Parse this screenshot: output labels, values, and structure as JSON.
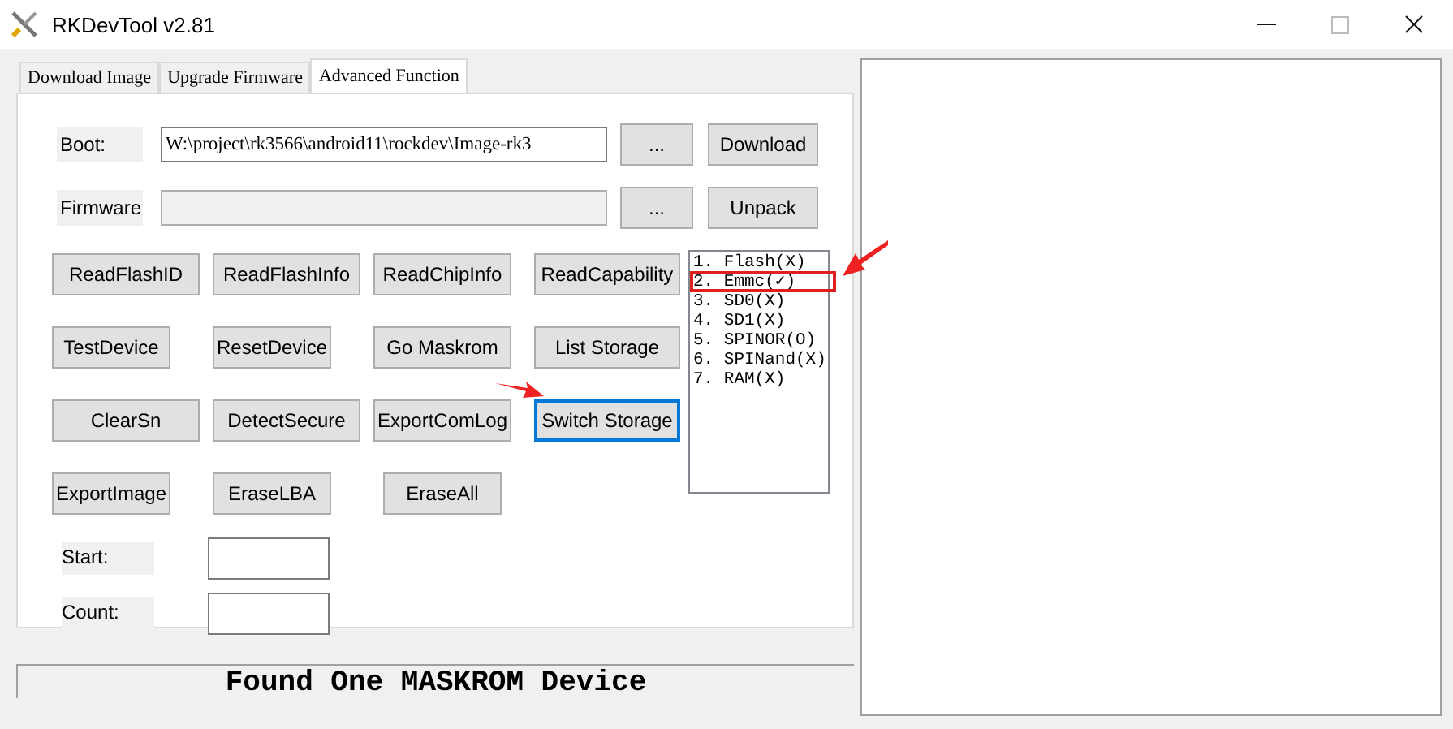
{
  "window": {
    "title": "RKDevTool v2.81"
  },
  "tabs": [
    {
      "label": "Download Image",
      "selected": false
    },
    {
      "label": "Upgrade Firmware",
      "selected": false
    },
    {
      "label": "Advanced Function",
      "selected": true
    }
  ],
  "boot": {
    "label": "Boot:",
    "value": "W:\\project\\rk3566\\android11\\rockdev\\Image-rk3",
    "browse": "...",
    "action": "Download"
  },
  "firmware": {
    "label": "Firmware",
    "browse": "...",
    "action": "Unpack"
  },
  "buttons": [
    {
      "label": "ReadFlashID",
      "focused": false,
      "pointed": false
    },
    {
      "label": "ReadFlashInfo",
      "focused": false,
      "pointed": false
    },
    {
      "label": "ReadChipInfo",
      "focused": false,
      "pointed": false
    },
    {
      "label": "ReadCapability",
      "focused": false,
      "pointed": false
    },
    {
      "label": "TestDevice",
      "focused": false,
      "pointed": false
    },
    {
      "label": "ResetDevice",
      "focused": false,
      "pointed": false
    },
    {
      "label": "Go Maskrom",
      "focused": false,
      "pointed": false
    },
    {
      "label": "List Storage",
      "focused": false,
      "pointed": false
    },
    {
      "label": "ClearSn",
      "focused": false,
      "pointed": false
    },
    {
      "label": "DetectSecure",
      "focused": false,
      "pointed": false
    },
    {
      "label": "ExportComLog",
      "focused": false,
      "pointed": false
    },
    {
      "label": "Switch Storage",
      "focused": true,
      "pointed": true
    },
    {
      "label": "ExportImage",
      "focused": false,
      "pointed": false
    },
    {
      "label": "EraseLBA",
      "focused": false,
      "pointed": false
    },
    {
      "label": "EraseAll",
      "focused": false,
      "pointed": false
    }
  ],
  "storage_list": [
    {
      "label": "1. Flash(X)",
      "highlighted": false
    },
    {
      "label": "2. Emmc(✓)",
      "highlighted": true
    },
    {
      "label": "3. SD0(X)",
      "highlighted": false
    },
    {
      "label": "4. SD1(X)",
      "highlighted": false
    },
    {
      "label": "5. SPINOR(O)",
      "highlighted": false
    },
    {
      "label": "6. SPINand(X)",
      "highlighted": false
    },
    {
      "label": "7. RAM(X)",
      "highlighted": false
    }
  ],
  "start": {
    "label": "Start:"
  },
  "count": {
    "label": "Count:"
  },
  "status_bar": "Found One MASKROM Device"
}
